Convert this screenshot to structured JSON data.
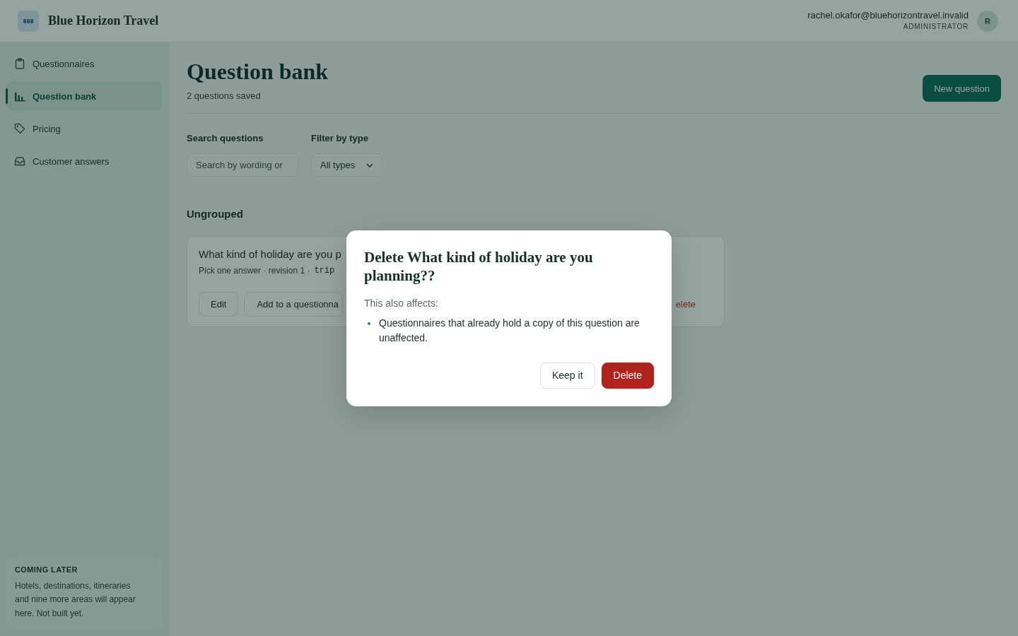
{
  "header": {
    "brand": "Blue Horizon Travel",
    "user": {
      "email": "rachel.okafor@bluehorizontravel.invalid",
      "role": "ADMINISTRATOR",
      "initial": "R"
    }
  },
  "sidebar": {
    "items": [
      {
        "label": "Questionnaires",
        "selected": false
      },
      {
        "label": "Question bank",
        "selected": true
      },
      {
        "label": "Pricing",
        "selected": false
      },
      {
        "label": "Customer answers",
        "selected": false
      }
    ],
    "notice": {
      "title": "COMING LATER",
      "text": "Hotels, destinations, itineraries and nine more areas will appear here. Not built yet."
    }
  },
  "main": {
    "title": "Question bank",
    "subtitle": "2 questions saved",
    "new_button": "New question",
    "filters": {
      "search": {
        "label": "Search questions",
        "placeholder": "Search by wording or"
      },
      "type": {
        "label": "Filter by type",
        "value": "All types"
      }
    },
    "groups": [
      {
        "title": "Ungrouped",
        "questions": [
          {
            "title": "What kind of holiday are you p",
            "meta": "Pick one answer · revision 1 ·",
            "code": "trip",
            "actions": [
              "Edit",
              "Add to a questionna"
            ],
            "delete": "elete"
          }
        ]
      }
    ]
  },
  "modal": {
    "title": "Delete What kind of holiday are you planning??",
    "intro": "This also affects:",
    "items": [
      "Questionnaires that already hold a copy of this question are unaffected."
    ],
    "buttons": [
      {
        "label": "Keep it",
        "kind": "secondary"
      },
      {
        "label": "Delete",
        "kind": "danger"
      }
    ]
  }
}
